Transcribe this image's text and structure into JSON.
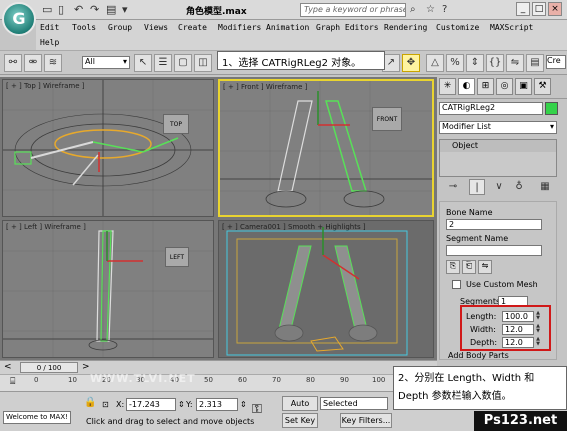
{
  "app": {
    "logo_glyph": "G",
    "doc_title": "角色模型.max",
    "search_placeholder": "Type a keyword or phrase",
    "quick_access": [
      "▭",
      "▯",
      "↶",
      "↷",
      "▤",
      "▾"
    ]
  },
  "menu": [
    "Edit",
    "Tools",
    "Group",
    "Views",
    "Create",
    "Modifiers",
    "Animation",
    "Graph Editors",
    "Rendering",
    "Customize",
    "MAXScript",
    "Help"
  ],
  "toolbar": {
    "selection_filter": "All",
    "named_selection": "Cre"
  },
  "callout1": "1、选择 CATRigRLeg2 对象。",
  "viewports": {
    "top": {
      "label": "[ + ] Top ] Wireframe ]",
      "navcube": "TOP"
    },
    "front": {
      "label": "[ + ] Front ] Wireframe ]",
      "navcube": "FRONT"
    },
    "left": {
      "label": "[ + ] Left ] Wireframe ]",
      "navcube": "LEFT"
    },
    "camera": {
      "label": "[ + ] Camera001 ] Smooth + Highlights ]"
    }
  },
  "command_panel": {
    "object_name": "CATRigRLeg2",
    "object_color": "#34d24a",
    "modifier_list": "Modifier List",
    "stack_item": "Object",
    "bone_name_label": "Bone Name",
    "bone_name_value": "2",
    "segment_name_label": "Segment Name",
    "use_custom_mesh": "Use Custom Mesh",
    "segments_label": "Segments",
    "segments_value": "1",
    "length_label": "Length:",
    "length_value": "100.0",
    "width_label": "Width:",
    "width_value": "12.0",
    "depth_label": "Depth:",
    "depth_value": "12.0",
    "add_body_parts": "Add Body Parts"
  },
  "timeline": {
    "frame_counter": "0 / 100",
    "ticks": [
      "0",
      "10",
      "20",
      "30",
      "40",
      "50",
      "60",
      "70",
      "80",
      "90",
      "100"
    ]
  },
  "status": {
    "listener_text": "Welcome to MAX!",
    "x_label": "X:",
    "x_value": "-17.243",
    "y_label": "Y:",
    "y_value": "2.313",
    "auto_key": "Auto Key",
    "set_key": "Set Key",
    "key_mode": "Selected",
    "key_filters": "Key Filters...",
    "prompt": "Click and drag to select and move objects"
  },
  "callout2": "2、分别在 Length、Width 和 Depth 参数栏输入数值。",
  "watermarks": {
    "brand": "Ps123.net",
    "site": "WWW.TLVI.NET"
  }
}
